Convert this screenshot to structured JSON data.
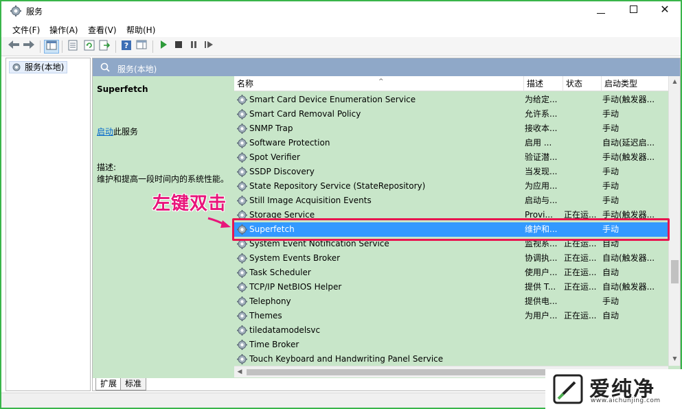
{
  "window": {
    "title": "服务",
    "close_glyph": "✕"
  },
  "menu": [
    "文件(F)",
    "操作(A)",
    "查看(V)",
    "帮助(H)"
  ],
  "tree": {
    "root_label": "服务(本地)"
  },
  "main": {
    "header_label": "服务(本地)",
    "selected_service": "Superfetch",
    "start_link": "启动",
    "start_suffix": "此服务",
    "desc_label": "描述:",
    "desc_text": "维护和提高一段时间内的系统性能。"
  },
  "columns": {
    "name": "名称",
    "desc": "描述",
    "status": "状态",
    "start": "启动类型"
  },
  "rows": [
    {
      "name": "Smart Card Device Enumeration Service",
      "desc": "为给定...",
      "status": "",
      "start": "手动(触发器..."
    },
    {
      "name": "Smart Card Removal Policy",
      "desc": "允许系...",
      "status": "",
      "start": "手动"
    },
    {
      "name": "SNMP Trap",
      "desc": "接收本...",
      "status": "",
      "start": "手动"
    },
    {
      "name": "Software Protection",
      "desc": "启用 ...",
      "status": "",
      "start": "自动(延迟启..."
    },
    {
      "name": "Spot Verifier",
      "desc": "验证潜...",
      "status": "",
      "start": "手动(触发器..."
    },
    {
      "name": "SSDP Discovery",
      "desc": "当发现...",
      "status": "",
      "start": "手动"
    },
    {
      "name": "State Repository Service (StateRepository)",
      "desc": "为应用...",
      "status": "",
      "start": "手动"
    },
    {
      "name": "Still Image Acquisition Events",
      "desc": "启动与...",
      "status": "",
      "start": "手动"
    },
    {
      "name": "Storage Service",
      "desc": "Provi...",
      "status": "正在运...",
      "start": "手动(触发器..."
    },
    {
      "name": "Superfetch",
      "desc": "维护和...",
      "status": "",
      "start": "手动",
      "selected": true
    },
    {
      "name": "System Event Notification Service",
      "desc": "监视系...",
      "status": "正在运...",
      "start": "自动"
    },
    {
      "name": "System Events Broker",
      "desc": "协调执...",
      "status": "正在运...",
      "start": "自动(触发器..."
    },
    {
      "name": "Task Scheduler",
      "desc": "使用户...",
      "status": "正在运...",
      "start": "自动"
    },
    {
      "name": "TCP/IP NetBIOS Helper",
      "desc": "提供 T...",
      "status": "正在运...",
      "start": "自动(触发器..."
    },
    {
      "name": "Telephony",
      "desc": "提供电...",
      "status": "",
      "start": "手动"
    },
    {
      "name": "Themes",
      "desc": "为用户...",
      "status": "正在运...",
      "start": "自动"
    },
    {
      "name": "tiledatamodelsvc",
      "desc": "",
      "status": "",
      "start": ""
    },
    {
      "name": "Time Broker",
      "desc": "",
      "status": "",
      "start": ""
    },
    {
      "name": "Touch Keyboard and Handwriting Panel Service",
      "desc": "",
      "status": "",
      "start": ""
    }
  ],
  "tabs": [
    "扩展",
    "标准"
  ],
  "annotation": "左键双击",
  "watermark": {
    "brand": "爱纯净",
    "url": "www.aichunjing.com"
  },
  "colors": {
    "window_border": "#39b54a",
    "list_background": "#c8e6c9",
    "selection": "#3399ff",
    "highlight_outline": "#e8154f",
    "annotation": "#e8157a",
    "header_bar": "#8fa8c8",
    "link": "#0066cc"
  },
  "icons": {
    "service": "gear-icon",
    "back": "arrow-left-icon",
    "forward": "arrow-right-icon",
    "play": "play-icon",
    "stop": "stop-icon",
    "pause": "pause-icon",
    "restart": "resume-icon"
  }
}
